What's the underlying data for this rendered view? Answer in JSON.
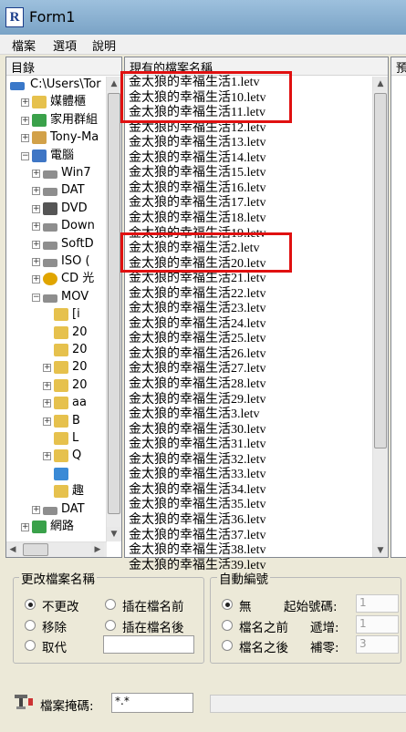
{
  "window": {
    "title": "Form1",
    "icon_letter": "R"
  },
  "menu": {
    "items": [
      "檔案",
      "選項",
      "說明"
    ]
  },
  "tree": {
    "header": "目錄",
    "rows": [
      {
        "label": "C:\\Users\\Tor",
        "indent": 0,
        "expander": "",
        "icon": "drive",
        "color": "#3a78c9"
      },
      {
        "label": "媒體櫃",
        "indent": 1,
        "expander": "+",
        "icon": "folder",
        "color": "#e6c14d"
      },
      {
        "label": "家用群組",
        "indent": 1,
        "expander": "+",
        "icon": "network",
        "color": "#3aa14a"
      },
      {
        "label": "Tony-Ma",
        "indent": 1,
        "expander": "+",
        "icon": "user",
        "color": "#d2a149"
      },
      {
        "label": "電腦",
        "indent": 1,
        "expander": "−",
        "icon": "computer",
        "color": "#3f76c5"
      },
      {
        "label": "Win7",
        "indent": 2,
        "expander": "+",
        "icon": "drive",
        "color": "#8e8e8e"
      },
      {
        "label": "DAT",
        "indent": 2,
        "expander": "+",
        "icon": "drive",
        "color": "#8e8e8e"
      },
      {
        "label": "DVD",
        "indent": 2,
        "expander": "+",
        "icon": "dvd",
        "color": "#555555"
      },
      {
        "label": "Down",
        "indent": 2,
        "expander": "+",
        "icon": "drive",
        "color": "#8e8e8e"
      },
      {
        "label": "SoftD",
        "indent": 2,
        "expander": "+",
        "icon": "drive",
        "color": "#8e8e8e"
      },
      {
        "label": "ISO (",
        "indent": 2,
        "expander": "+",
        "icon": "drive",
        "color": "#8e8e8e"
      },
      {
        "label": "CD 光",
        "indent": 2,
        "expander": "+",
        "icon": "cd",
        "color": "#e0a500"
      },
      {
        "label": "MOV",
        "indent": 2,
        "expander": "−",
        "icon": "drive",
        "color": "#8e8e8e"
      },
      {
        "label": "[i",
        "indent": 3,
        "expander": "",
        "icon": "folder",
        "color": "#e6c14d"
      },
      {
        "label": "20",
        "indent": 3,
        "expander": "",
        "icon": "folder",
        "color": "#e6c14d"
      },
      {
        "label": "20",
        "indent": 3,
        "expander": "",
        "icon": "folder",
        "color": "#e6c14d"
      },
      {
        "label": "20",
        "indent": 3,
        "expander": "+",
        "icon": "folder",
        "color": "#e6c14d"
      },
      {
        "label": "20",
        "indent": 3,
        "expander": "+",
        "icon": "folder",
        "color": "#e6c14d"
      },
      {
        "label": "aa",
        "indent": 3,
        "expander": "+",
        "icon": "folder",
        "color": "#e6c14d"
      },
      {
        "label": "B",
        "indent": 3,
        "expander": "+",
        "icon": "folder",
        "color": "#e6c14d"
      },
      {
        "label": "L",
        "indent": 3,
        "expander": "",
        "icon": "folder",
        "color": "#e6c14d"
      },
      {
        "label": "Q",
        "indent": 3,
        "expander": "+",
        "icon": "folder",
        "color": "#e6c14d"
      },
      {
        "label": "",
        "indent": 3,
        "expander": "",
        "icon": "folder-open",
        "color": "#3a8ad6"
      },
      {
        "label": "趣",
        "indent": 3,
        "expander": "",
        "icon": "folder",
        "color": "#e6c14d"
      },
      {
        "label": "DAT",
        "indent": 2,
        "expander": "+",
        "icon": "drive",
        "color": "#8e8e8e"
      },
      {
        "label": "網路",
        "indent": 1,
        "expander": "+",
        "icon": "network",
        "color": "#3aa14a"
      }
    ]
  },
  "files": {
    "header": "現有的檔案名稱",
    "items": [
      "金太狼的幸福生活1.letv",
      "金太狼的幸福生活10.letv",
      "金太狼的幸福生活11.letv",
      "金太狼的幸福生活12.letv",
      "金太狼的幸福生活13.letv",
      "金太狼的幸福生活14.letv",
      "金太狼的幸福生活15.letv",
      "金太狼的幸福生活16.letv",
      "金太狼的幸福生活17.letv",
      "金太狼的幸福生活18.letv",
      "金太狼的幸福生活19.letv",
      "金太狼的幸福生活2.letv",
      "金太狼的幸福生活20.letv",
      "金太狼的幸福生活21.letv",
      "金太狼的幸福生活22.letv",
      "金太狼的幸福生活23.letv",
      "金太狼的幸福生活24.letv",
      "金太狼的幸福生活25.letv",
      "金太狼的幸福生活26.letv",
      "金太狼的幸福生活27.letv",
      "金太狼的幸福生活28.letv",
      "金太狼的幸福生活29.letv",
      "金太狼的幸福生活3.letv",
      "金太狼的幸福生活30.letv",
      "金太狼的幸福生活31.letv",
      "金太狼的幸福生活32.letv",
      "金太狼的幸福生活33.letv",
      "金太狼的幸福生活34.letv",
      "金太狼的幸福生活35.letv",
      "金太狼的幸福生活36.letv",
      "金太狼的幸福生活37.letv",
      "金太狼的幸福生活38.letv",
      "金太狼的幸福生活39.letv"
    ],
    "highlight_color": "#e01010"
  },
  "third_pane": {
    "header": "預"
  },
  "rename_group": {
    "legend": "更改檔案名稱",
    "options": [
      "不更改",
      "插在檔名前",
      "移除",
      "插在檔名後",
      "取代"
    ],
    "selected": "不更改",
    "replace_value": ""
  },
  "numbering_group": {
    "legend": "自動編號",
    "options": [
      "無",
      "檔名之前",
      "檔名之後"
    ],
    "selected": "無",
    "start_label": "起始號碼:",
    "start_value": "1",
    "step_label": "遞增:",
    "step_value": "1",
    "pad_label": "補零:",
    "pad_value": "3"
  },
  "mask": {
    "label": "檔案掩碼:",
    "value": "*.*",
    "icon": "filter-icon"
  }
}
